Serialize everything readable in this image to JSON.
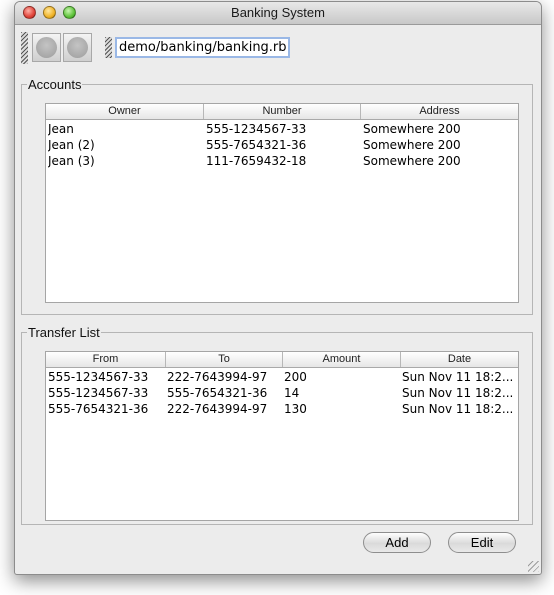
{
  "window": {
    "title": "Banking System"
  },
  "toolbar": {
    "buttons": [
      {
        "icon": "circle-button-icon"
      },
      {
        "icon": "circle-button-icon"
      }
    ],
    "path_value": "demo/banking/banking.rb"
  },
  "accounts": {
    "label": "Accounts",
    "columns": [
      "Owner",
      "Number",
      "Address"
    ],
    "rows": [
      [
        "Jean",
        "555-1234567-33",
        "Somewhere 200"
      ],
      [
        "Jean (2)",
        "555-7654321-36",
        "Somewhere 200"
      ],
      [
        "Jean (3)",
        "111-7659432-18",
        "Somewhere 200"
      ]
    ]
  },
  "transfers": {
    "label": "Transfer List",
    "columns": [
      "From",
      "To",
      "Amount",
      "Date"
    ],
    "rows": [
      [
        "555-1234567-33",
        "222-7643994-97",
        "200",
        "Sun Nov 11 18:2..."
      ],
      [
        "555-1234567-33",
        "555-7654321-36",
        "14",
        "Sun Nov 11 18:2..."
      ],
      [
        "555-7654321-36",
        "222-7643994-97",
        "130",
        "Sun Nov 11 18:2..."
      ]
    ]
  },
  "actions": {
    "add_label": "Add",
    "edit_label": "Edit"
  }
}
